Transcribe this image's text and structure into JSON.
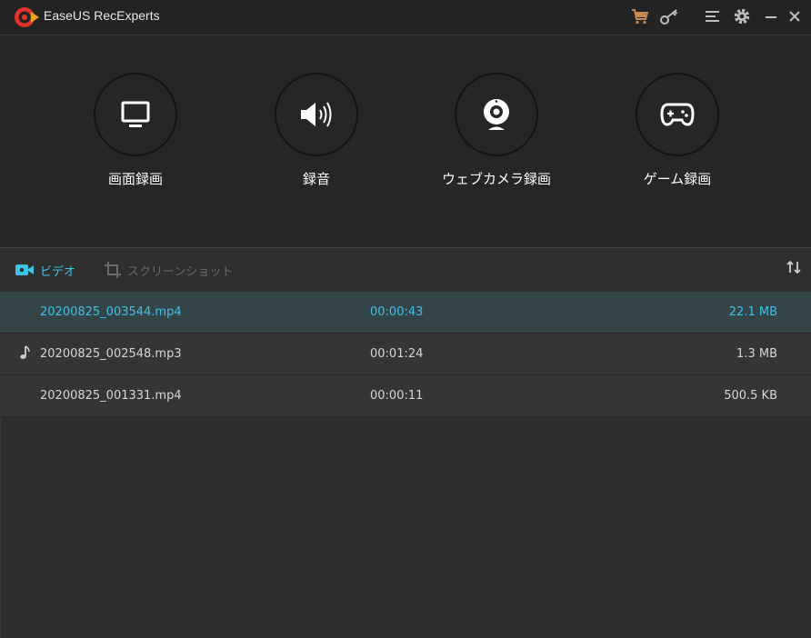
{
  "app": {
    "title": "EaseUS RecExperts"
  },
  "titlebar": {
    "icons": [
      "cart-icon",
      "key-icon",
      "menu-icon",
      "gear-icon",
      "minimize-icon",
      "close-icon"
    ]
  },
  "modes": [
    {
      "label": "画面録画",
      "icon": "monitor-icon"
    },
    {
      "label": "録音",
      "icon": "speaker-icon"
    },
    {
      "label": "ウェブカメラ録画",
      "icon": "webcam-icon"
    },
    {
      "label": "ゲーム録画",
      "icon": "gamepad-icon"
    }
  ],
  "tabs": [
    {
      "label": "ビデオ",
      "icon": "video-icon",
      "active": true
    },
    {
      "label": "スクリーンショット",
      "icon": "crop-icon",
      "active": false
    }
  ],
  "files": [
    {
      "name": "20200825_003544.mp4",
      "duration": "00:00:43",
      "size": "22.1 MB",
      "selected": true
    },
    {
      "name": "20200825_002548.mp3",
      "duration": "00:01:24",
      "size": "1.3 MB",
      "selected": false
    },
    {
      "name": "20200825_001331.mp4",
      "duration": "00:00:11",
      "size": "500.5 KB",
      "selected": false
    }
  ],
  "colors": {
    "accent": "#3ec2e8",
    "logo_red": "#e2342f",
    "cart": "#c8884f"
  }
}
